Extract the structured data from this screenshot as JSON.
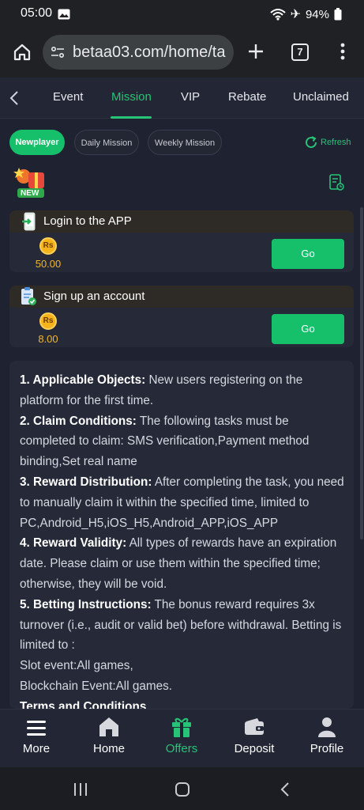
{
  "status": {
    "time": "05:00",
    "battery": "94%"
  },
  "browser": {
    "url": "betaa03.com/home/ta",
    "tab_count": "7"
  },
  "nav": {
    "tabs": [
      {
        "label": "Event"
      },
      {
        "label": "Mission"
      },
      {
        "label": "VIP"
      },
      {
        "label": "Rebate"
      },
      {
        "label": "Unclaimed"
      }
    ],
    "active_tab": "Mission"
  },
  "filters": {
    "chips": [
      {
        "label": "Newplayer"
      },
      {
        "label": "Daily Mission"
      },
      {
        "label": "Weekly Mission"
      }
    ],
    "refresh_label": "Refresh"
  },
  "badge": {
    "new_label": "NEW"
  },
  "tasks": [
    {
      "title": "Login to the APP",
      "currency": "Rs",
      "reward": "50.00",
      "button": "Go"
    },
    {
      "title": "Sign up an account",
      "currency": "Rs",
      "reward": "8.00",
      "button": "Go"
    }
  ],
  "rules": {
    "items": [
      {
        "heading": "1. Applicable Objects:",
        "text": " New users registering on the platform for the first time."
      },
      {
        "heading": "2. Claim Conditions:",
        "text": " The following tasks must be completed to claim: SMS verification,Payment method binding,Set real name"
      },
      {
        "heading": "3. Reward Distribution:",
        "text": " After completing the task, you need to manually claim it within the specified time, limited to PC,Android_H5,iOS_H5,Android_APP,iOS_APP"
      },
      {
        "heading": "4. Reward Validity:",
        "text": " All types of rewards have an expiration date. Please claim or use them within the specified time; otherwise, they will be void."
      },
      {
        "heading": "5. Betting Instructions:",
        "text": " The bonus reward requires 3x turnover (i.e., audit or valid bet) before withdrawal. Betting is limited to :"
      }
    ],
    "extra_lines": [
      "Slot event:All games,",
      "Blockchain Event:All games."
    ],
    "terms_heading": "Terms and Conditions"
  },
  "bottom_nav": {
    "items": [
      {
        "label": "More",
        "icon": "menu-icon"
      },
      {
        "label": "Home",
        "icon": "home-icon"
      },
      {
        "label": "Offers",
        "icon": "gift-icon"
      },
      {
        "label": "Deposit",
        "icon": "wallet-icon"
      },
      {
        "label": "Profile",
        "icon": "profile-icon"
      }
    ],
    "active": "Offers"
  },
  "colors": {
    "accent": "#16c06b",
    "background": "#1f2230",
    "coin": "#f4b31a"
  }
}
